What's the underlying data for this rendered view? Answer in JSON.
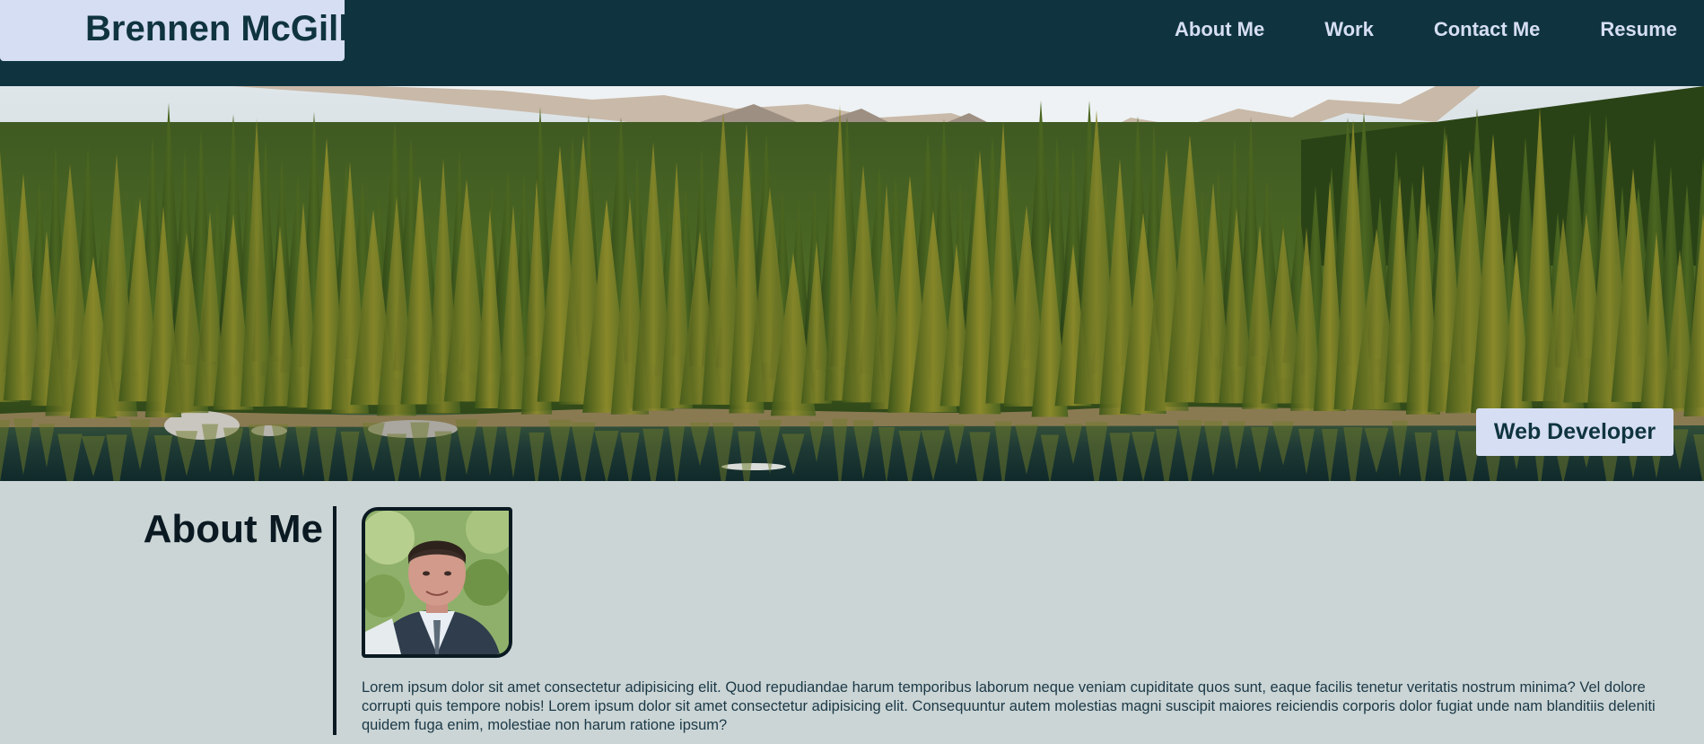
{
  "header": {
    "brand_name": "Brennen McGill",
    "nav": [
      {
        "label": "About Me"
      },
      {
        "label": "Work"
      },
      {
        "label": "Contact Me"
      },
      {
        "label": "Resume"
      }
    ]
  },
  "hero": {
    "role": "Web Developer"
  },
  "about": {
    "heading": "About Me",
    "bio": "Lorem ipsum dolor sit amet consectetur adipisicing elit. Quod repudiandae harum temporibus laborum neque veniam cupiditate quos sunt, eaque facilis tenetur veritatis nostrum minima? Vel dolore corrupti quis tempore nobis! Lorem ipsum dolor sit amet consectetur adipisicing elit. Consequuntur autem molestias magni suscipit maiores reiciendis corporis dolor fugiat unde nam blanditiis deleniti quidem fuga enim, molestiae non harum ratione ipsum?"
  },
  "colors": {
    "header_bg": "#0f3440",
    "accent_light": "#d6def3",
    "page_bg": "#cbd5d6"
  }
}
